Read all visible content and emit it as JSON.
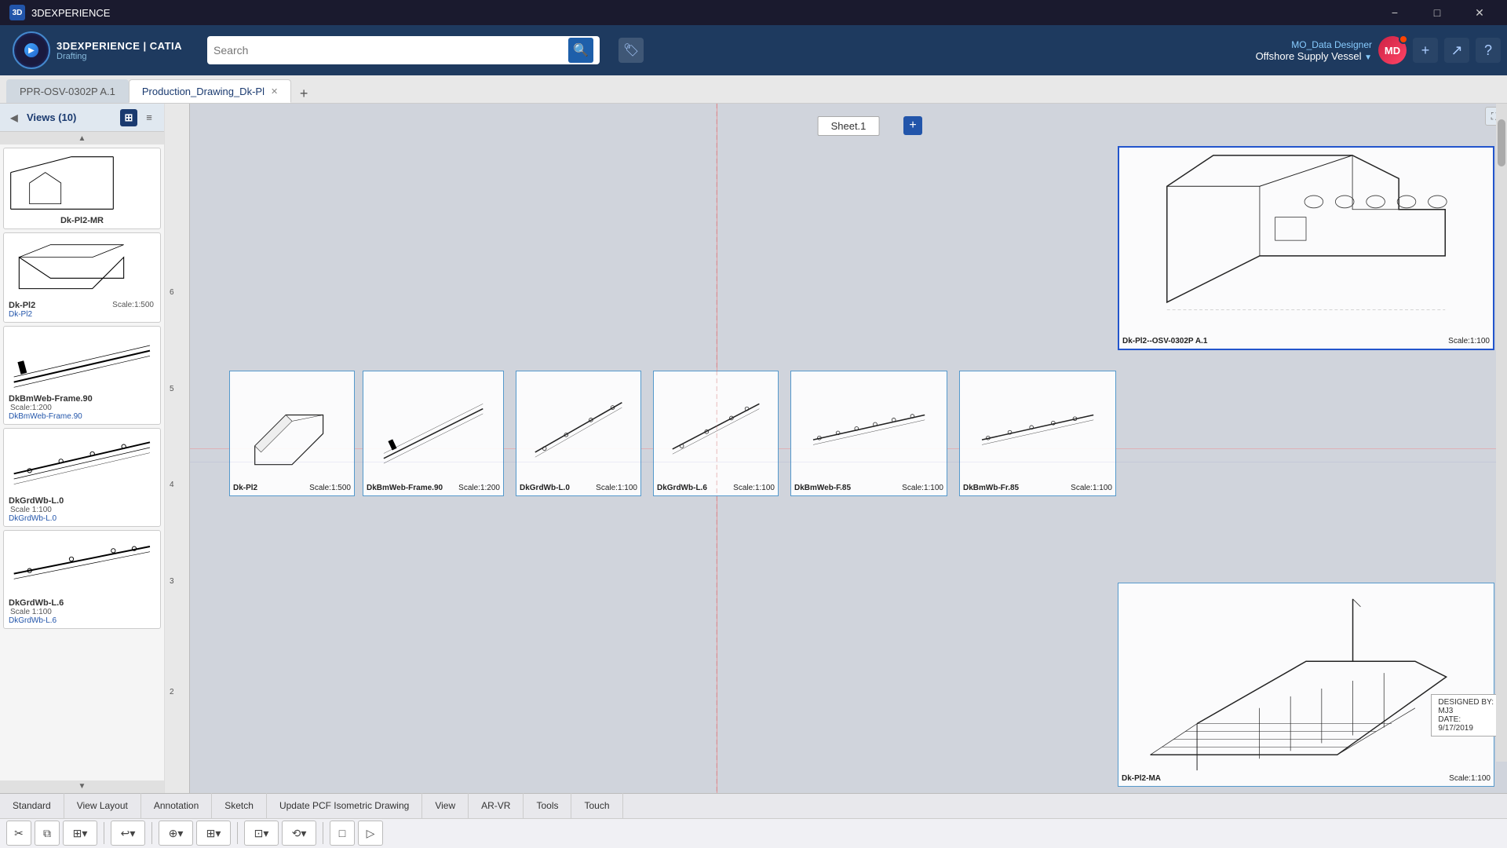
{
  "titlebar": {
    "app_name": "3DEXPERIENCE",
    "min_label": "−",
    "max_label": "□",
    "close_label": "✕"
  },
  "toolbar": {
    "brand_main": "3DEXPERIENCE | CATIA",
    "brand_sub": "Drafting",
    "search_placeholder": "Search",
    "user_name_label": "MO_Data Designer",
    "user_org": "Offshore Supply Vessel",
    "user_initials": "MD"
  },
  "tabs": [
    {
      "id": "tab1",
      "label": "PPR-OSV-0302P A.1",
      "active": false
    },
    {
      "id": "tab2",
      "label": "Production_Drawing_Dk-Pl",
      "active": true
    }
  ],
  "left_panel": {
    "title": "Views (10)",
    "views": [
      {
        "name": "Dk-Pl2-MR",
        "scale_label": "",
        "sub_label": "Dk-Pl2-MR",
        "thumb_type": "dk_pl2_ma_top"
      },
      {
        "name": "Dk-Pl2",
        "scale_label": "Scale:1:500",
        "sub_label": "Dk-Pl2",
        "thumb_type": "dk_pl2"
      },
      {
        "name": "DkBmWeb-Frame.90",
        "scale_label": "Scale:1:200",
        "sub_label": "DkBmWeb-Frame.90",
        "thumb_type": "frame90"
      },
      {
        "name": "DkGrdWb-L.0",
        "scale_label": "Scale 1:100",
        "sub_label": "DkGrdWb-L.0",
        "thumb_type": "grd_l0"
      },
      {
        "name": "DkGrdWb-L.6",
        "scale_label": "Scale 1:100",
        "sub_label": "DkGrdWb-L.6",
        "thumb_type": "grd_l6"
      }
    ]
  },
  "drawing": {
    "sheet_label": "Sheet.1",
    "views": [
      {
        "id": "view_main_top",
        "title": "Dk-Pl2--OSV-0302P A.1",
        "scale": "Scale:1:100",
        "selected": true
      },
      {
        "id": "view_dk_pl2",
        "title": "Dk-Pl2",
        "scale": "Scale:1:500",
        "selected": false
      },
      {
        "id": "view_frame90",
        "title": "DkBmWeb-Frame.90",
        "scale": "Scale:1:200",
        "selected": false
      },
      {
        "id": "view_grd_l0",
        "title": "DkGrdWb-L.0",
        "scale": "Scale:1:100",
        "selected": false
      },
      {
        "id": "view_grd_l6",
        "title": "DkGrdWb-L.6",
        "scale": "Scale:1:100",
        "selected": false
      },
      {
        "id": "view_bmweb_f85",
        "title": "DkBmWeb-F.85",
        "scale": "Scale:1:100",
        "selected": false
      },
      {
        "id": "view_bmweb_fr85",
        "title": "DkBmWb-Fr.85",
        "scale": "Scale:1:100",
        "selected": false
      },
      {
        "id": "view_bottom_iso",
        "title": "Dk-Pl2-MA",
        "scale": "Scale:1:100",
        "selected": false
      }
    ],
    "ruler_labels_v": [
      "6",
      "5",
      "4",
      "3",
      "2"
    ],
    "stamp": {
      "designed_by_label": "DESIGNED BY:",
      "designed_by": "MJ3",
      "date_label": "DATE:",
      "date": "9/17/2019"
    }
  },
  "bottom_tabs": [
    {
      "label": "Standard"
    },
    {
      "label": "View Layout"
    },
    {
      "label": "Annotation"
    },
    {
      "label": "Sketch"
    },
    {
      "label": "Update PCF Isometric Drawing"
    },
    {
      "label": "View"
    },
    {
      "label": "AR-VR"
    },
    {
      "label": "Tools"
    },
    {
      "label": "Touch"
    }
  ],
  "action_bar": {
    "buttons": [
      "✂",
      "⧉",
      "⊞",
      "↩",
      "↺",
      "⊕",
      "⊞",
      "⊡",
      "⟲",
      "▷"
    ]
  },
  "icons": {
    "search": "🔍",
    "tag": "🏷",
    "add": "+",
    "chevron_left": "◀",
    "chevron_right": "▶",
    "grid_view": "⊞",
    "list_view": "≡",
    "close": "✕",
    "minimize": "−",
    "maximize": "□",
    "play": "▶",
    "user": "MD",
    "expand": "⛶"
  }
}
